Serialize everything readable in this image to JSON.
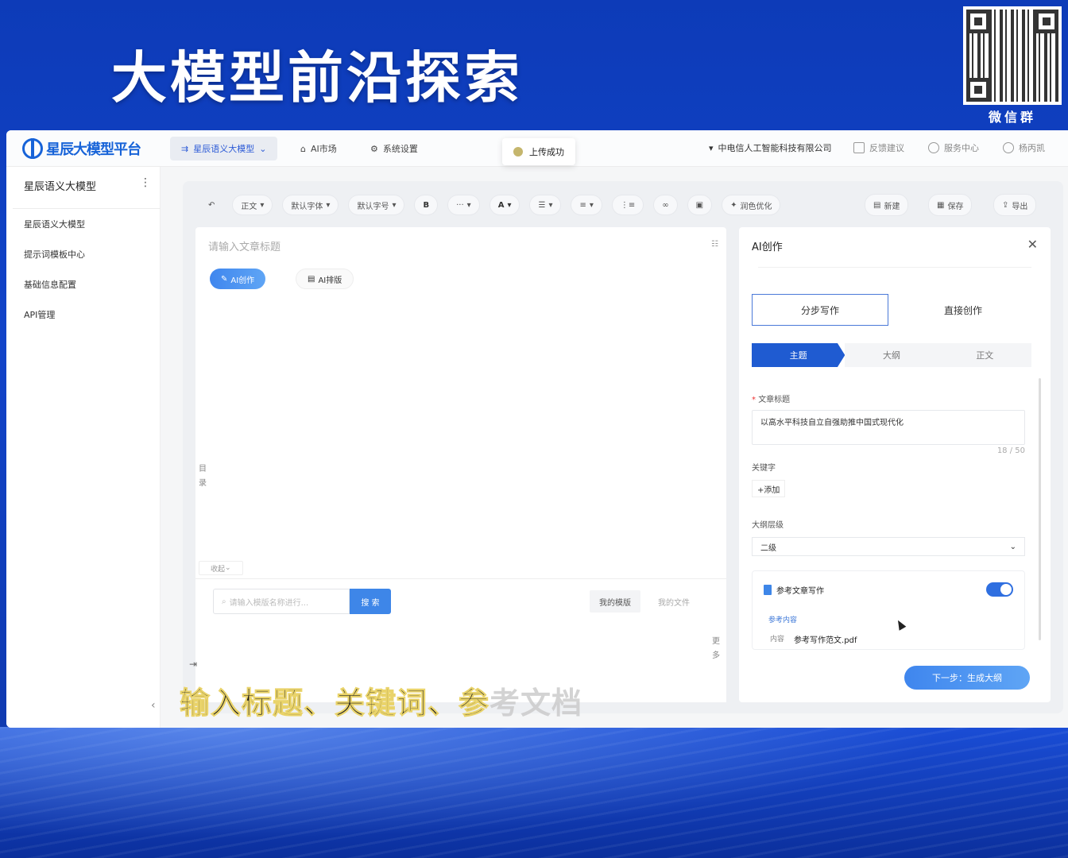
{
  "banner": {
    "title": "大模型前沿探索",
    "qr_caption": "微信群"
  },
  "topbar": {
    "logo": "星辰大模型平台",
    "nav": [
      "星辰语义大模型",
      "AI市场",
      "系统设置"
    ],
    "toast": "上传成功",
    "org": "中电信人工智能科技有限公司",
    "feedback": "反馈建议",
    "service": "服务中心",
    "user": "杨丙凯"
  },
  "sidebar": {
    "title": "星辰语义大模型",
    "more": "⋮",
    "items": [
      "星辰语义大模型",
      "提示词模板中心",
      "基础信息配置",
      "API管理"
    ],
    "collapse": "‹"
  },
  "toolbar": {
    "undo": "↶",
    "paragraph": "正文",
    "font": "默认字体",
    "size": "默认字号",
    "bold": "B",
    "more": "···",
    "color": "A",
    "polish": "润色优化",
    "new": "新建",
    "save": "保存",
    "export": "导出"
  },
  "editor": {
    "title_placeholder": "请输入文章标题",
    "ai_create": "AI创作",
    "ai_layout": "AI排版",
    "toc": "目录",
    "collapse": "收起",
    "search_placeholder": "请输入模版名称进行...",
    "search_btn": "搜 索",
    "tab_mine": "我的模版",
    "tab_files": "我的文件",
    "more": "更多"
  },
  "ai_panel": {
    "title": "AI创作",
    "mode_step": "分步写作",
    "mode_direct": "直接创作",
    "steps": [
      "主题",
      "大纲",
      "正文"
    ],
    "title_label": "文章标题",
    "title_value": "以高水平科技自立自强助推中国式现代化",
    "count": "18 / 50",
    "keyword_label": "关键字",
    "add_keyword": "+添加",
    "outline_label": "大纲层级",
    "outline_value": "二级",
    "ref_title": "参考文章写作",
    "ref_sub": "参考内容",
    "ref_tag": "内容",
    "ref_file": "参考写作范文.pdf",
    "next": "下一步：生成大纲"
  },
  "caption": {
    "main": "输入标题、关键词、参",
    "dim": "考文档"
  },
  "colors": {
    "accent": "#1f5bd1",
    "button": "#3e86e8",
    "banner": "#0d3bb8"
  }
}
